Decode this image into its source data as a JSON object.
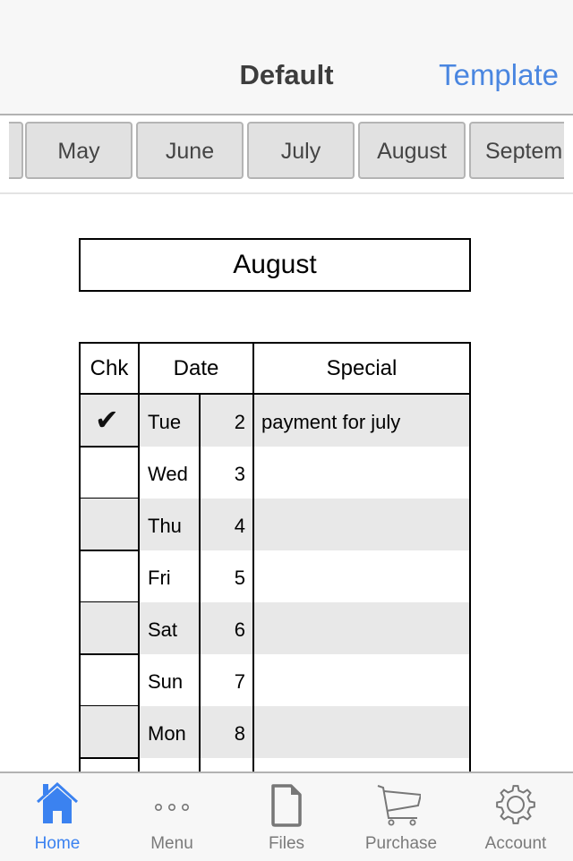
{
  "navbar": {
    "title": "Default",
    "right_button": "Template"
  },
  "month_tabs": [
    "",
    "May",
    "June",
    "July",
    "August",
    "Septem"
  ],
  "selected_month": "August",
  "table": {
    "headers": {
      "chk": "Chk",
      "date": "Date",
      "special": "Special"
    },
    "rows": [
      {
        "checked": true,
        "day": "Tue",
        "num": "2",
        "special": "payment for july"
      },
      {
        "checked": false,
        "day": "Wed",
        "num": "3",
        "special": ""
      },
      {
        "checked": false,
        "day": "Thu",
        "num": "4",
        "special": ""
      },
      {
        "checked": false,
        "day": "Fri",
        "num": "5",
        "special": ""
      },
      {
        "checked": false,
        "day": "Sat",
        "num": "6",
        "special": ""
      },
      {
        "checked": false,
        "day": "Sun",
        "num": "7",
        "special": ""
      },
      {
        "checked": false,
        "day": "Mon",
        "num": "8",
        "special": ""
      },
      {
        "checked": false,
        "day": "",
        "num": "",
        "special": ""
      }
    ],
    "check_glyph": "✔"
  },
  "tabbar": {
    "items": [
      {
        "label": "Home",
        "icon": "home-icon",
        "active": true
      },
      {
        "label": "Menu",
        "icon": "more-icon",
        "active": false
      },
      {
        "label": "Files",
        "icon": "file-icon",
        "active": false
      },
      {
        "label": "Purchase",
        "icon": "cart-icon",
        "active": false
      },
      {
        "label": "Account",
        "icon": "gear-icon",
        "active": false
      }
    ]
  },
  "colors": {
    "accent": "#3b82f0",
    "link": "#4a86e0",
    "row_shade": "#e8e8e8",
    "tab_bg": "#e1e1e1"
  }
}
